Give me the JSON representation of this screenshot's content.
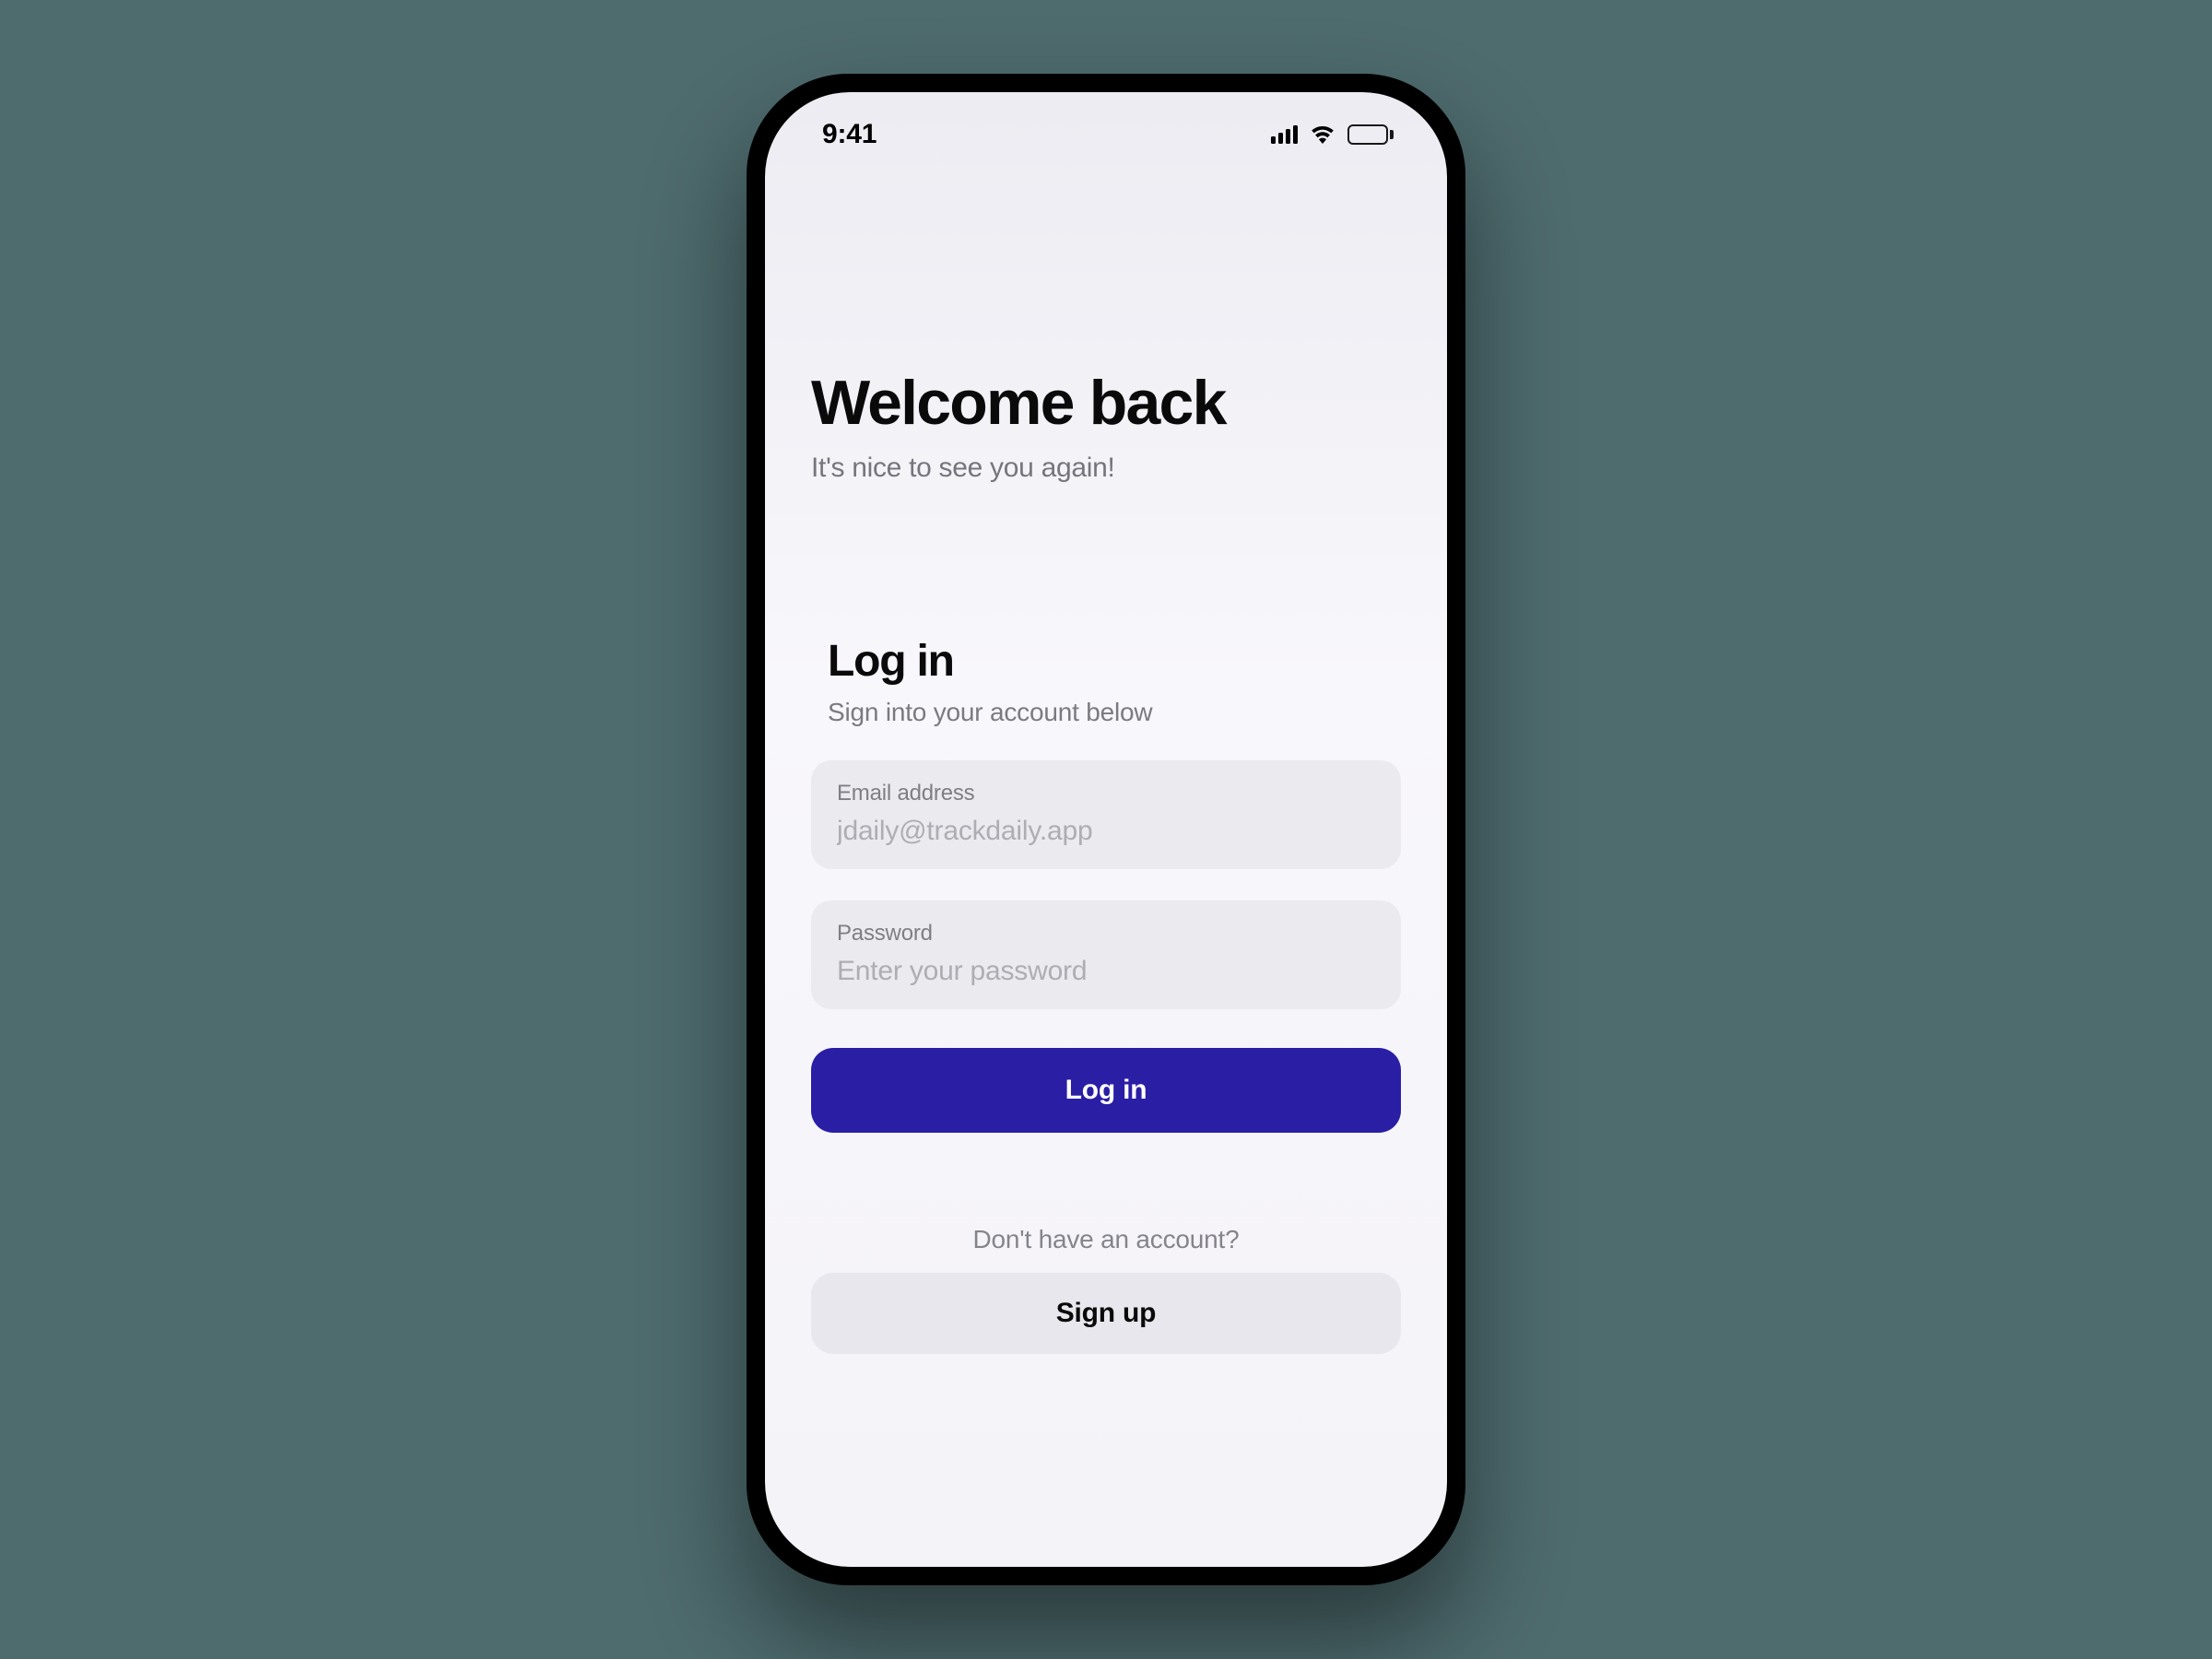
{
  "status": {
    "time": "9:41"
  },
  "header": {
    "title": "Welcome back",
    "subtitle": "It's nice to see you again!"
  },
  "form": {
    "title": "Log in",
    "subtitle": "Sign into your account below"
  },
  "email": {
    "label": "Email address",
    "placeholder": "jdaily@trackdaily.app",
    "value": ""
  },
  "password": {
    "label": "Password",
    "placeholder": "Enter your password",
    "value": ""
  },
  "buttons": {
    "login": "Log in",
    "signup": "Sign up"
  },
  "signup": {
    "prompt": "Don't have an account?"
  },
  "colors": {
    "primary": "#2a1ea5",
    "field_bg": "#eaeaef",
    "secondary_bg": "#e8e7ed",
    "text_muted": "#7b7a81"
  }
}
